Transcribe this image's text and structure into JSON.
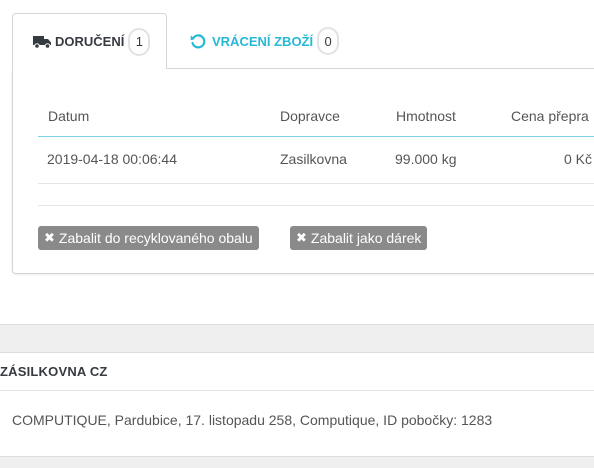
{
  "tabs": [
    {
      "label": "DORUČENÍ",
      "count": "1",
      "icon": "truck-icon"
    },
    {
      "label": "VRÁCENÍ ZBOŽÍ",
      "count": "0",
      "icon": "undo-icon"
    }
  ],
  "table": {
    "headers": [
      "Datum",
      "Dopravce",
      "Hmotnost",
      "Cena přepra"
    ],
    "rows": [
      {
        "date": "2019-04-18 00:06:44",
        "carrier": "Zasilkovna",
        "weight": "99.000 kg",
        "price": "0 Kč"
      }
    ]
  },
  "options": {
    "recycled": "Zabalit do recyklovaného obalu",
    "gift": "Zabalit jako dárek"
  },
  "carrier_section": {
    "title": "ZÁSILKOVNA CZ",
    "detail": "COMPUTIQUE, Pardubice, 17. listopadu 258, Computique, ID pobočky: 1283"
  },
  "colors": {
    "accent": "#25b9d7",
    "tab_text": "#363a41",
    "button_gray": "#8a8a8a"
  }
}
